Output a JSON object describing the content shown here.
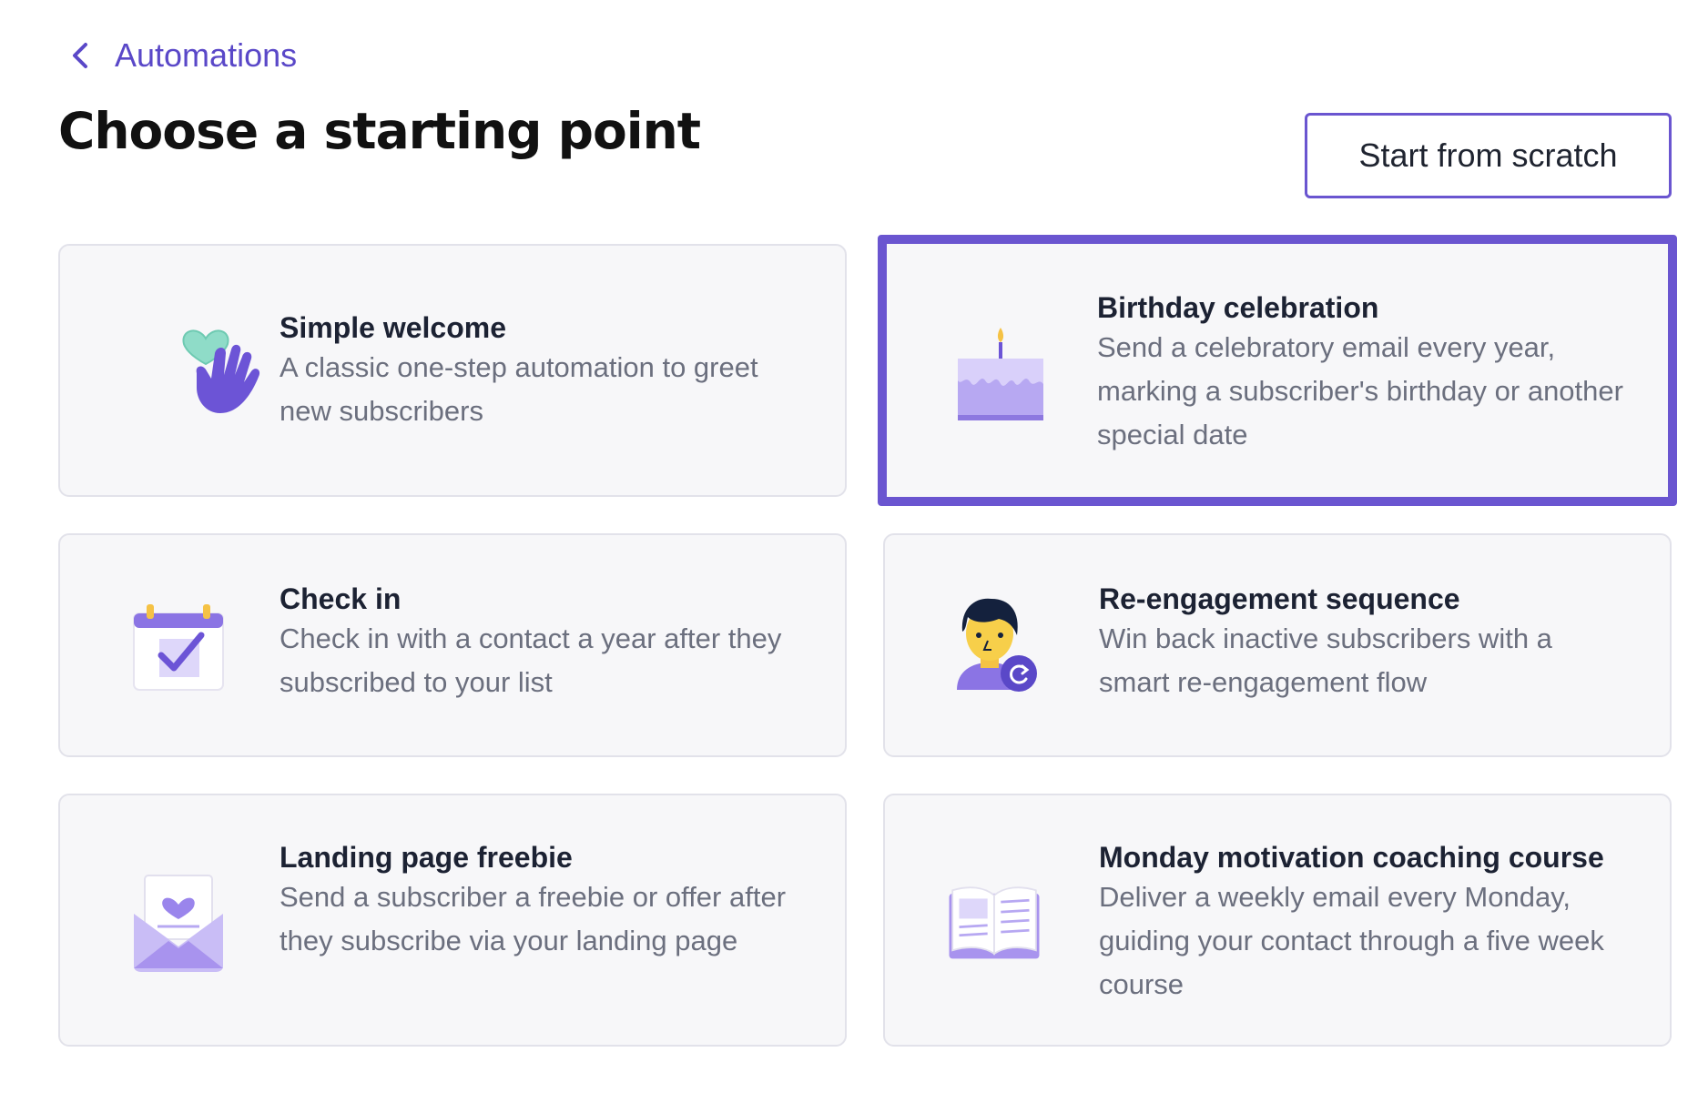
{
  "breadcrumb": {
    "label": "Automations"
  },
  "header": {
    "title": "Choose a starting point"
  },
  "actions": {
    "scratch_label": "Start from scratch"
  },
  "colors": {
    "accent": "#6a55d0",
    "card_bg": "#f7f7f9",
    "card_border": "#e2e2ea",
    "title_text": "#1c2233",
    "desc_text": "#6b6f7e"
  },
  "cards": [
    {
      "icon": "heart-hand-icon",
      "title": "Simple welcome",
      "description": "A classic one-step automation to greet new subscribers"
    },
    {
      "icon": "birthday-cake-icon",
      "title": "Birthday celebration",
      "description": "Send a celebratory email every year, marking a subscriber's birthday or another special date",
      "selected": true
    },
    {
      "icon": "calendar-check-icon",
      "title": "Check in",
      "description": "Check in with a contact a year after they subscribed to your list"
    },
    {
      "icon": "person-refresh-icon",
      "title": "Re-engagement sequence",
      "description": "Win back inactive subscribers with a smart re-engagement flow"
    },
    {
      "icon": "envelope-letter-icon",
      "title": "Landing page freebie",
      "description": "Send a subscriber a freebie or offer after they subscribe via your landing page"
    },
    {
      "icon": "open-book-icon",
      "title": "Monday motivation coaching course",
      "description": "Deliver a weekly email every Monday, guiding your contact through a five week course"
    }
  ]
}
